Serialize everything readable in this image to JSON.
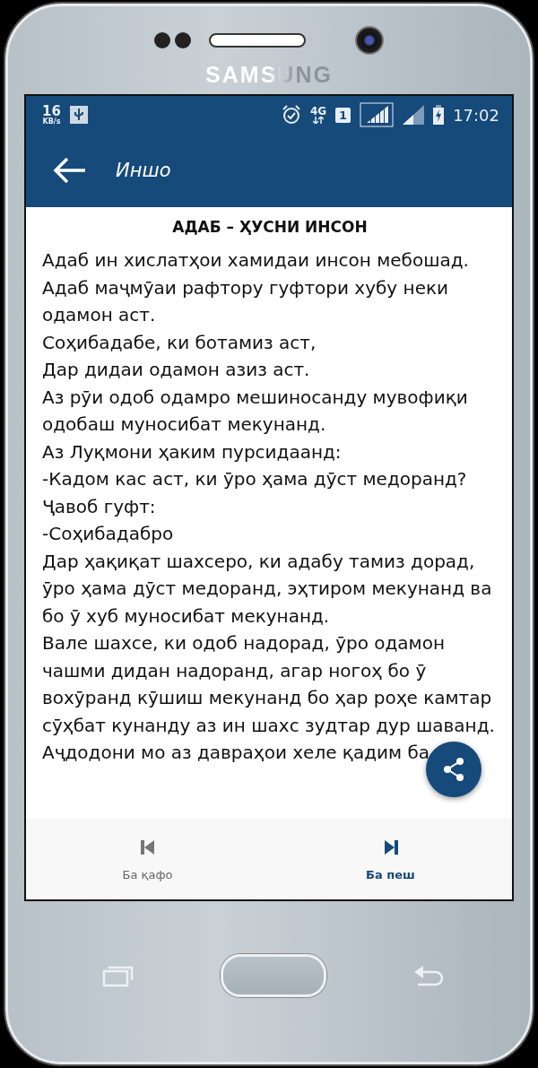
{
  "phone": {
    "brand": "SAMSUNG"
  },
  "status_bar": {
    "speed": "16",
    "speed_unit": "KB/s",
    "network": "4G",
    "sim": "1",
    "time": "17:02"
  },
  "app_bar": {
    "title": "Иншо"
  },
  "article": {
    "heading": "АДАБ – ҲУСНИ ИНСОН",
    "paragraphs": [
      "Адаб ин хислатҳои хамидаи инсон мебошад.",
      "Адаб маҷмӯаи рафтору гуфтори хубу неки одамон аст.",
      "Соҳибадабе, ки ботамиз аст,",
      "Дар дидаи одамон азиз аст.",
      "Аз рӯи одоб одамро мешиносанду мувофиқи одобаш муносибат мекунанд.",
      "Аз Луқмони ҳаким пурсидаанд:",
      "-Кадом кас аст, ки ӯро ҳама дӯст медоранд?",
      "Ҷавоб гуфт:",
      "-Соҳибадабро",
      "Дар ҳақиқат шахсеро, ки адабу тамиз дорад, ӯро ҳама дӯст медоранд, эҳтиром мекунанд ва бо ӯ хуб муносибат мекунанд.",
      "Вале шахсе, ки одоб надорад, ӯро одамон чашми дидан надоранд, агар ногоҳ бо ӯ вохӯранд кӯшиш мекунанд бо ҳар роҳе камтар сӯҳбат кунанду аз ин шахс зудтар дур шаванд.",
      "Аҷдодони мо аз давраҳои хеле қадим ба"
    ]
  },
  "bottom_nav": [
    {
      "label": "Ба қафо",
      "kind": "previous",
      "selected": false
    },
    {
      "label": "Ба пеш",
      "kind": "next",
      "selected": true
    }
  ]
}
